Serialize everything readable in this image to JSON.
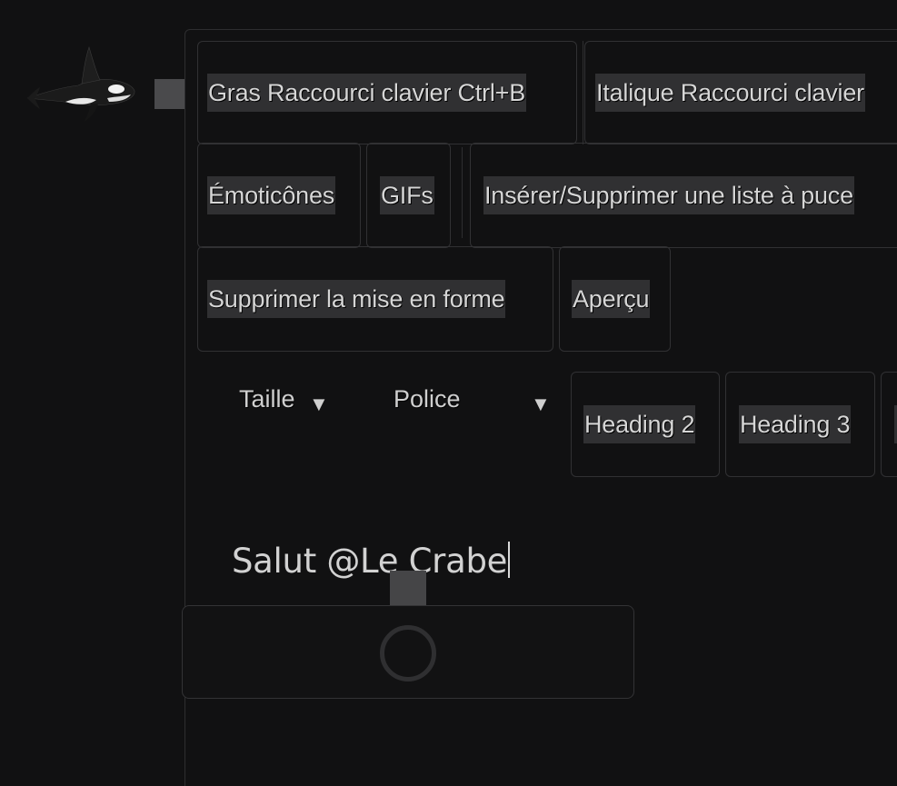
{
  "toolbar": {
    "bold": "Gras Raccourci clavier Ctrl+B",
    "italic": "Italique Raccourci clavier",
    "emoji": "Émoticônes",
    "gifs": "GIFs",
    "bullet_list": "Insérer/Supprimer une liste à puce",
    "clear_format": "Supprimer la mise en forme",
    "preview": "Aperçu",
    "size_select": "Taille",
    "size_caret": "▼",
    "font_select": "Police",
    "font_caret": "▼",
    "heading2": "Heading 2",
    "heading3": "Heading 3"
  },
  "editor": {
    "content": "Salut @Le Crabe"
  },
  "icons": {
    "avatar": "orca-icon",
    "loading": "spinner-icon"
  },
  "colors": {
    "background": "#111112",
    "button_label_bg": "#303032",
    "border": "#313133"
  }
}
